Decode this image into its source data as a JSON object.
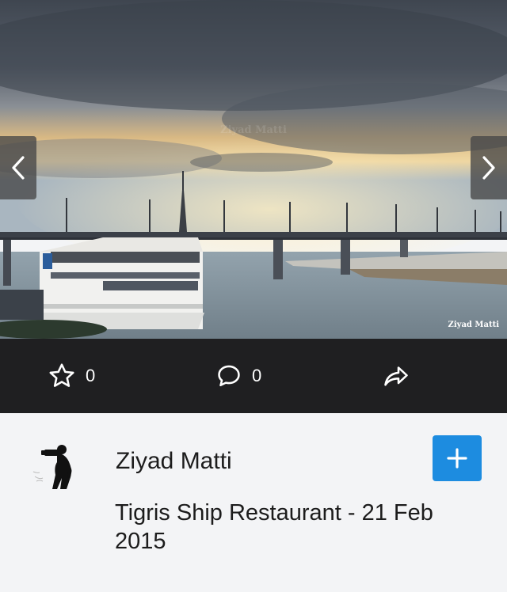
{
  "photo": {
    "watermark_center": "Ziyad Matti",
    "watermark_corner": "Ziyad Matti"
  },
  "navigation": {
    "prev_icon": "chevron-left-icon",
    "next_icon": "chevron-right-icon"
  },
  "actions": {
    "favorites_count": "0",
    "comments_count": "0",
    "star_icon": "star-icon",
    "comment_icon": "comment-icon",
    "share_icon": "share-icon"
  },
  "post": {
    "author": "Ziyad Matti",
    "title": "Tigris Ship Restaurant - 21 Feb 2015"
  },
  "add_button": {
    "icon": "plus-icon"
  },
  "colors": {
    "action_bar": "#1f1f21",
    "accent": "#1d8ce0",
    "background": "#f3f4f6"
  }
}
